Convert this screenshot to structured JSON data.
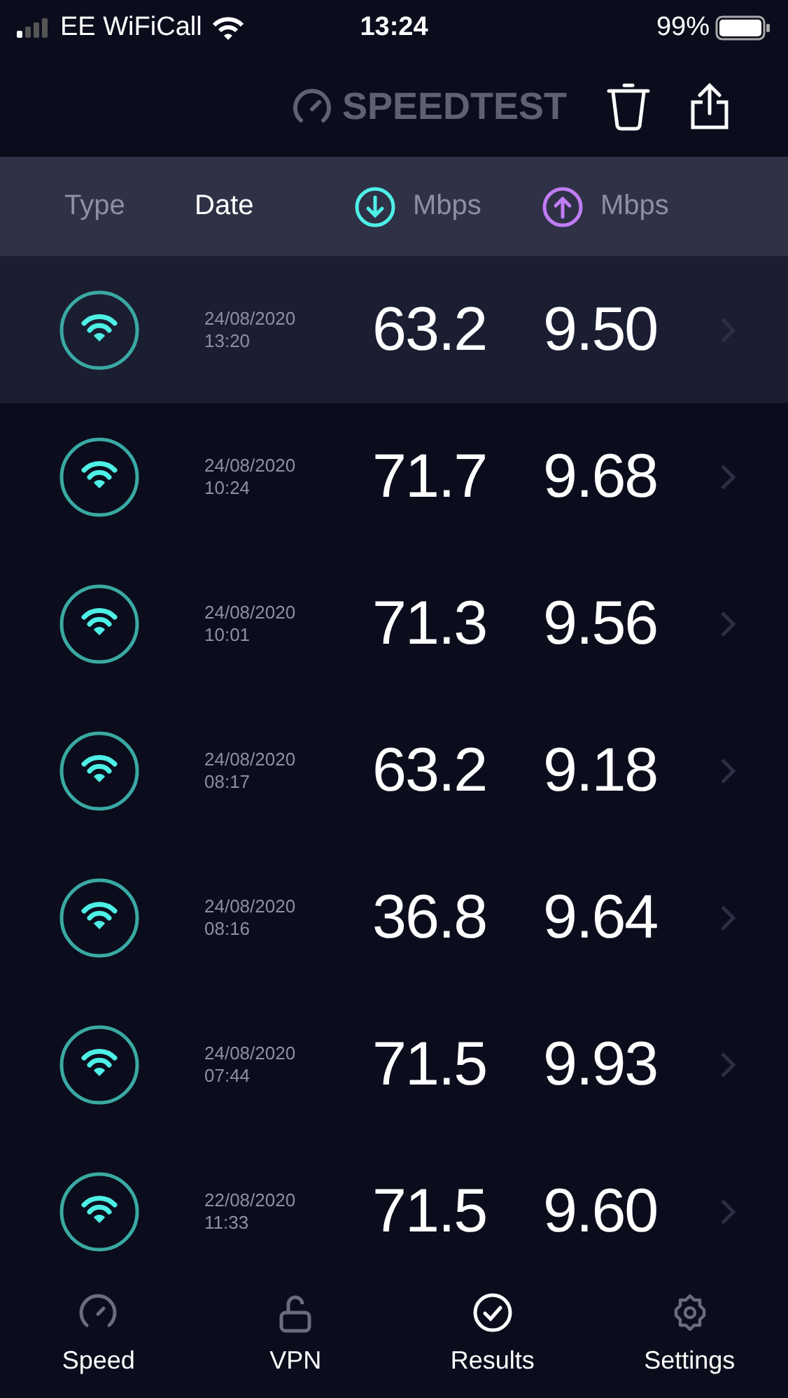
{
  "status_bar": {
    "carrier": "EE WiFiCall",
    "time": "13:24",
    "battery": "99%"
  },
  "header": {
    "logo": "SPEEDTEST"
  },
  "columns": [
    {
      "label": "Type",
      "selected": false,
      "kind": "text"
    },
    {
      "label": "Date",
      "selected": true,
      "kind": "text"
    },
    {
      "label": "Mbps",
      "selected": false,
      "kind": "download"
    },
    {
      "label": "Mbps",
      "selected": false,
      "kind": "upload"
    }
  ],
  "results": [
    {
      "date": "24/08/2020",
      "time": "13:20",
      "download": "63.2",
      "upload": "9.50",
      "selected": true
    },
    {
      "date": "24/08/2020",
      "time": "10:24",
      "download": "71.7",
      "upload": "9.68",
      "selected": false
    },
    {
      "date": "24/08/2020",
      "time": "10:01",
      "download": "71.3",
      "upload": "9.56",
      "selected": false
    },
    {
      "date": "24/08/2020",
      "time": "08:17",
      "download": "63.2",
      "upload": "9.18",
      "selected": false
    },
    {
      "date": "24/08/2020",
      "time": "08:16",
      "download": "36.8",
      "upload": "9.64",
      "selected": false
    },
    {
      "date": "24/08/2020",
      "time": "07:44",
      "download": "71.5",
      "upload": "9.93",
      "selected": false
    },
    {
      "date": "22/08/2020",
      "time": "11:33",
      "download": "71.5",
      "upload": "9.60",
      "selected": false
    }
  ],
  "tabs": [
    {
      "label": "Speed",
      "kind": "speed",
      "selected": false
    },
    {
      "label": "VPN",
      "kind": "vpn",
      "selected": false
    },
    {
      "label": "Results",
      "kind": "results",
      "selected": true
    },
    {
      "label": "Settings",
      "kind": "settings",
      "selected": false
    }
  ]
}
